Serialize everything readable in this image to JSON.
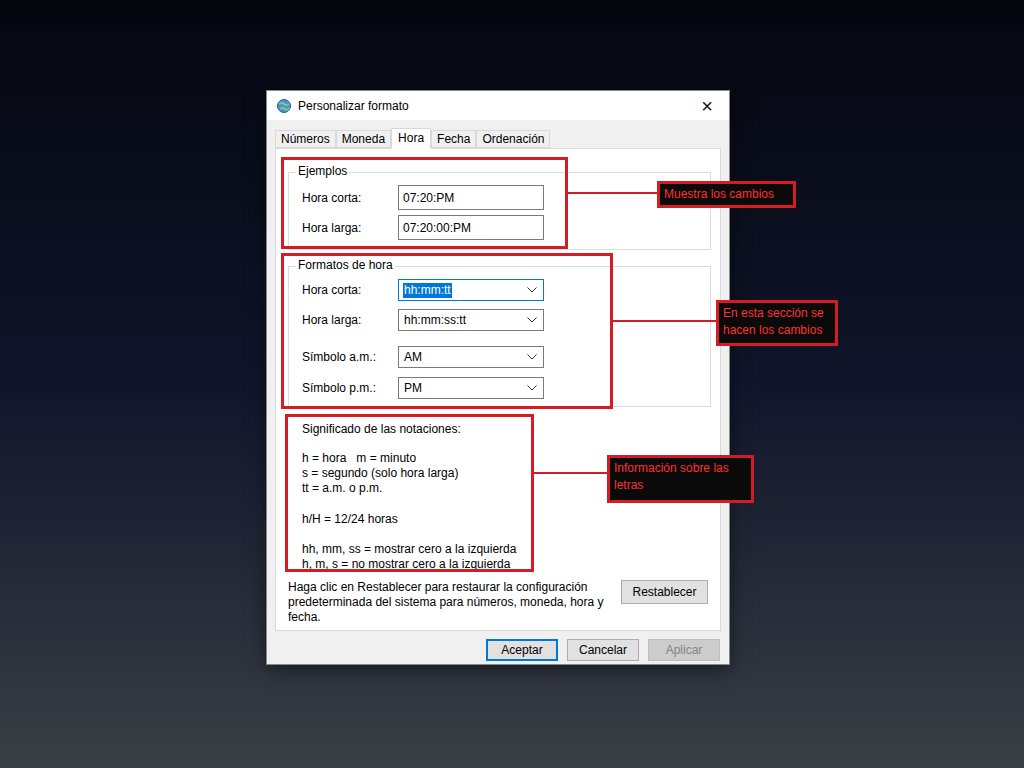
{
  "window": {
    "title": "Personalizar formato",
    "close": "×"
  },
  "tabs": [
    {
      "label": "Números",
      "selected": false
    },
    {
      "label": "Moneda",
      "selected": false
    },
    {
      "label": "Hora",
      "selected": true
    },
    {
      "label": "Fecha",
      "selected": false
    },
    {
      "label": "Ordenación",
      "selected": false
    }
  ],
  "examples": {
    "title": "Ejemplos",
    "rows": [
      {
        "label": "Hora corta:",
        "value": "07:20:PM"
      },
      {
        "label": "Hora larga:",
        "value": "07:20:00:PM"
      }
    ]
  },
  "formats": {
    "title": "Formatos de hora",
    "rows": [
      {
        "label": "Hora corta:",
        "value": "hh:mm:tt",
        "selected": true
      },
      {
        "label": "Hora larga:",
        "value": "hh:mm:ss:tt",
        "selected": false
      },
      {
        "label": "Símbolo a.m.:",
        "value": "AM",
        "selected": false
      },
      {
        "label": "Símbolo p.m.:",
        "value": "PM",
        "selected": false
      }
    ]
  },
  "notations": {
    "title": "Significado de las notaciones:",
    "groups": [
      [
        "h = hora   m = minuto",
        "s = segundo (solo hora larga)",
        "tt = a.m. o p.m."
      ],
      [
        "h/H = 12/24 horas"
      ],
      [
        "hh, mm, ss = mostrar cero a la izquierda",
        "h, m, s = no mostrar cero a la izquierda"
      ]
    ]
  },
  "reset": {
    "text": "Haga clic en Restablecer para restaurar la configuración predeterminada del sistema para números, moneda, hora y fecha.",
    "button": "Restablecer"
  },
  "buttons": [
    {
      "label": "Aceptar",
      "disabled": false,
      "default": true
    },
    {
      "label": "Cancelar",
      "disabled": false,
      "default": false
    },
    {
      "label": "Aplicar",
      "disabled": true,
      "default": false
    }
  ],
  "annotations": [
    {
      "text": "Muestra los cambios"
    },
    {
      "text": "En esta sección se hacen los cambios"
    },
    {
      "text": "Información sobre las letras"
    }
  ]
}
